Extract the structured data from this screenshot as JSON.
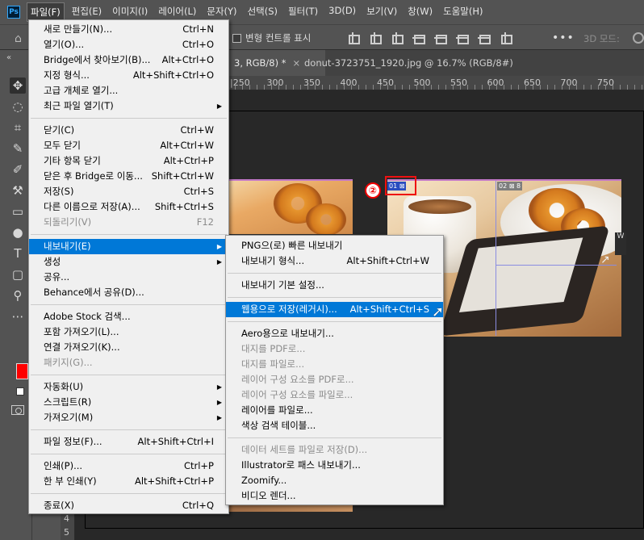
{
  "app": {
    "logo": "Ps",
    "menubar": [
      "파일(F)",
      "편집(E)",
      "이미지(I)",
      "레이어(L)",
      "문자(Y)",
      "선택(S)",
      "필터(T)",
      "3D(D)",
      "보기(V)",
      "창(W)",
      "도움말(H)"
    ]
  },
  "options": {
    "transform_label": "변형 컨트롤 표시",
    "more": "•••",
    "mode3d": "3D 모드:"
  },
  "tabs": [
    {
      "label": "3, RGB/8) *",
      "close": "×"
    },
    {
      "label": "donut-3723751_1920.jpg @ 16.7% (RGB/8#) *",
      "close": "×"
    }
  ],
  "ruler": {
    "numbers": [
      "|250",
      "300",
      "350",
      "400",
      "450",
      "500",
      "550",
      "600",
      "650",
      "700",
      "750"
    ],
    "vertical": [
      "4",
      "5"
    ]
  },
  "canvas": {
    "badge": "②",
    "slice1": "01",
    "slice2": "02",
    "slice3": "8",
    "side_tab": "W"
  },
  "file_menu": {
    "items": [
      {
        "label": "새로 만들기(N)...",
        "shortcut": "Ctrl+N"
      },
      {
        "label": "열기(O)...",
        "shortcut": "Ctrl+O"
      },
      {
        "label": "Bridge에서 찾아보기(B)...",
        "shortcut": "Alt+Ctrl+O"
      },
      {
        "label": "지정 형식...",
        "shortcut": "Alt+Shift+Ctrl+O"
      },
      {
        "label": "고급 개체로 열기...",
        "shortcut": ""
      },
      {
        "label": "최근 파일 열기(T)",
        "shortcut": "",
        "submenu": true
      },
      {
        "sep": true
      },
      {
        "label": "닫기(C)",
        "shortcut": "Ctrl+W"
      },
      {
        "label": "모두 닫기",
        "shortcut": "Alt+Ctrl+W"
      },
      {
        "label": "기타 항목 닫기",
        "shortcut": "Alt+Ctrl+P"
      },
      {
        "label": "닫은 후 Bridge로 이동...",
        "shortcut": "Shift+Ctrl+W"
      },
      {
        "label": "저장(S)",
        "shortcut": "Ctrl+S"
      },
      {
        "label": "다른 이름으로 저장(A)...",
        "shortcut": "Shift+Ctrl+S"
      },
      {
        "label": "되돌리기(V)",
        "shortcut": "F12",
        "disabled": true
      },
      {
        "sep": true
      },
      {
        "label": "내보내기(E)",
        "shortcut": "",
        "submenu": true,
        "highlight": true
      },
      {
        "label": "생성",
        "shortcut": "",
        "submenu": true
      },
      {
        "label": "공유...",
        "shortcut": ""
      },
      {
        "label": "Behance에서 공유(D)...",
        "shortcut": ""
      },
      {
        "sep": true
      },
      {
        "label": "Adobe Stock 검색...",
        "shortcut": ""
      },
      {
        "label": "포함 가져오기(L)...",
        "shortcut": ""
      },
      {
        "label": "연결 가져오기(K)...",
        "shortcut": ""
      },
      {
        "label": "패키지(G)...",
        "shortcut": "",
        "disabled": true
      },
      {
        "sep": true
      },
      {
        "label": "자동화(U)",
        "shortcut": "",
        "submenu": true
      },
      {
        "label": "스크립트(R)",
        "shortcut": "",
        "submenu": true
      },
      {
        "label": "가져오기(M)",
        "shortcut": "",
        "submenu": true
      },
      {
        "sep": true
      },
      {
        "label": "파일 정보(F)...",
        "shortcut": "Alt+Shift+Ctrl+I"
      },
      {
        "sep": true
      },
      {
        "label": "인쇄(P)...",
        "shortcut": "Ctrl+P"
      },
      {
        "label": "한 부 인쇄(Y)",
        "shortcut": "Alt+Shift+Ctrl+P"
      },
      {
        "sep": true
      },
      {
        "label": "종료(X)",
        "shortcut": "Ctrl+Q"
      }
    ]
  },
  "export_menu": {
    "items": [
      {
        "label": "PNG으(로) 빠른 내보내기",
        "shortcut": ""
      },
      {
        "label": "내보내기 형식...",
        "shortcut": "Alt+Shift+Ctrl+W"
      },
      {
        "sep": true
      },
      {
        "label": "내보내기 기본 설정...",
        "shortcut": ""
      },
      {
        "sep": true
      },
      {
        "label": "웹용으로 저장(레거시)...",
        "shortcut": "Alt+Shift+Ctrl+S",
        "highlight": true
      },
      {
        "sep": true
      },
      {
        "label": "Aero용으로 내보내기...",
        "shortcut": ""
      },
      {
        "label": "대지를 PDF로...",
        "shortcut": "",
        "disabled": true
      },
      {
        "label": "대지를 파일로...",
        "shortcut": "",
        "disabled": true
      },
      {
        "label": "레이어 구성 요소를 PDF로...",
        "shortcut": "",
        "disabled": true
      },
      {
        "label": "레이어 구성 요소를 파일로...",
        "shortcut": "",
        "disabled": true
      },
      {
        "label": "레이어를 파일로...",
        "shortcut": ""
      },
      {
        "label": "색상 검색 테이블...",
        "shortcut": ""
      },
      {
        "sep": true
      },
      {
        "label": "데이터 세트를 파일로 저장(D)...",
        "shortcut": "",
        "disabled": true
      },
      {
        "label": "Illustrator로 패스 내보내기...",
        "shortcut": ""
      },
      {
        "label": "Zoomify...",
        "shortcut": ""
      },
      {
        "label": "비디오 렌더...",
        "shortcut": ""
      }
    ]
  },
  "colors": {
    "foreground": "#ff0000",
    "highlight": "#0078d7",
    "annotation": "#ee1111"
  }
}
